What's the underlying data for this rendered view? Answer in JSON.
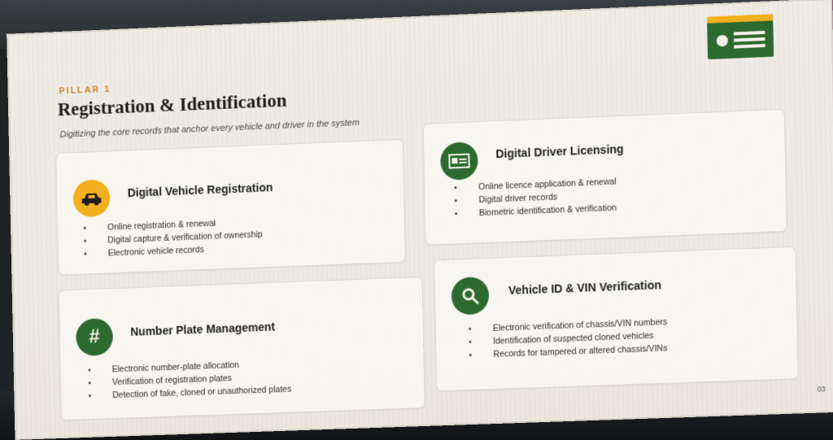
{
  "slide": {
    "eyebrow": "PILLAR 1",
    "title": "Registration & Identification",
    "subtitle": "Digitizing the core records that anchor every vehicle and driver in the system",
    "page_number": "03"
  },
  "cards": [
    {
      "title": "Digital Vehicle Registration",
      "icon": "car-icon",
      "icon_color": "#f2b01e",
      "items": [
        "Online registration & renewal",
        "Digital capture & verification of ownership",
        "Electronic vehicle records"
      ]
    },
    {
      "title": "Digital Driver Licensing",
      "icon": "id-card-icon",
      "icon_color": "#2d6a2f",
      "items": [
        "Online licence application & renewal",
        "Digital driver records",
        "Biometric identification & verification"
      ]
    },
    {
      "title": "Number Plate Management",
      "icon": "hash-icon",
      "icon_color": "#2d6a2f",
      "items": [
        "Electronic number-plate allocation",
        "Verification of registration plates",
        "Detection of fake, cloned or unauthorized plates"
      ]
    },
    {
      "title": "Vehicle ID & VIN Verification",
      "icon": "magnifier-icon",
      "icon_color": "#2d6a2f",
      "items": [
        "Electronic verification of chassis/VIN numbers",
        "Identification of suspected cloned vehicles",
        "Records for tampered or altered chassis/VINs"
      ]
    }
  ],
  "colors": {
    "accent": "#c9852f",
    "green": "#2d6a2f",
    "yellow": "#f2b01e"
  }
}
